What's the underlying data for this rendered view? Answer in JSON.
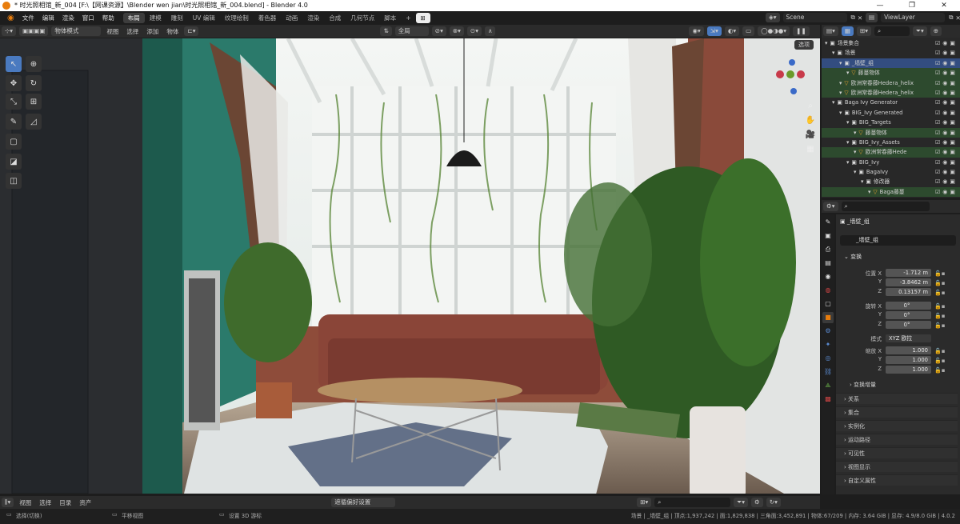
{
  "window": {
    "title": "* 时光照相馆_新_004 [F:\\【网课资源】\\Blender wen jian\\时光照相馆_新_004.blend] - Blender 4.0",
    "buttons": [
      "—",
      "❐",
      "✕"
    ]
  },
  "topmenu": [
    "文件",
    "编辑",
    "渲染",
    "窗口",
    "帮助"
  ],
  "workspaces": [
    "布局",
    "建模",
    "雕刻",
    "UV 编辑",
    "纹理绘制",
    "着色器",
    "动画",
    "渲染",
    "合成",
    "几何节点",
    "脚本"
  ],
  "active_workspace": "布局",
  "scene": {
    "label": "Scene",
    "viewlayer": "ViewLayer"
  },
  "viewport_header": {
    "mode": "物体模式",
    "menus": [
      "视图",
      "选择",
      "添加",
      "物体"
    ],
    "transform_orientation": "全局",
    "options": "选项"
  },
  "outliner": {
    "search_placeholder": "",
    "rows": [
      {
        "label": "场景集合",
        "indent": 0
      },
      {
        "label": "场景",
        "indent": 1
      },
      {
        "label": "_墙壁_组",
        "indent": 2,
        "hl": true
      },
      {
        "label": "藤蔓物体",
        "indent": 3,
        "grn": true
      },
      {
        "label": "欧洲常春藤Hedera_helix",
        "indent": 2,
        "grn": true
      },
      {
        "label": "欧洲常春藤Hedera_helix",
        "indent": 2,
        "grn": true
      },
      {
        "label": "Baga Ivy Generator",
        "indent": 1
      },
      {
        "label": "BIG_Ivy Generated",
        "indent": 2
      },
      {
        "label": "BIG_Targets",
        "indent": 3
      },
      {
        "label": "藤蔓物体",
        "indent": 4,
        "grn": true
      },
      {
        "label": "BIG_Ivy_Assets",
        "indent": 3
      },
      {
        "label": "欧洲常春藤Hede",
        "indent": 4,
        "grn": true
      },
      {
        "label": "BIG_Ivy",
        "indent": 3
      },
      {
        "label": "BagaIvy",
        "indent": 4
      },
      {
        "label": "修改器",
        "indent": 5
      },
      {
        "label": "Baga藤蔓",
        "indent": 6,
        "grn": true
      }
    ]
  },
  "properties": {
    "object_name": "_墙壁_组",
    "data_name": "_墙壁_组",
    "transform_title": "变换",
    "location_label": "位置 X",
    "loc": [
      "-1.712 m",
      "-3.8462 m",
      "0.13157 m"
    ],
    "rotation_label": "旋转 X",
    "rot": [
      "0°",
      "0°",
      "0°"
    ],
    "mode_label": "模式",
    "mode_value": "XYZ 欧拉",
    "scale_label": "缩放 X",
    "scale": [
      "1.000",
      "1.000",
      "1.000"
    ],
    "axis_y": "Y",
    "axis_z": "Z",
    "delta": "变换增量",
    "sections": [
      "关系",
      "集合",
      "实例化",
      "运动路径",
      "可见性",
      "视图显示",
      "自定义属性"
    ]
  },
  "bottom_header": {
    "menus": [
      "视图",
      "选择",
      "目录",
      "资产"
    ],
    "center": "遮循偏好设置"
  },
  "status": {
    "left1": "选择(切换)",
    "left2": "平移视图",
    "left3": "设置 3D 游标",
    "right": "场景 | _墙壁_组 | 顶点:1,937,242 | 面:1,829,838 | 三角面:3,452,891 | 物体:67/209 | 内存: 3.64 GiB | 显存: 4.9/8.0 GiB | 4.0.2"
  }
}
